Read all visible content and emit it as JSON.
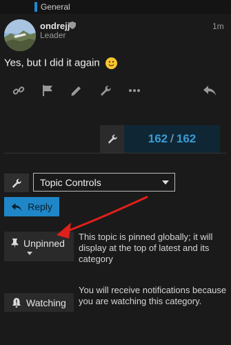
{
  "header": {
    "category": "General",
    "category_color": "#1e88d1"
  },
  "post": {
    "username": "ondrejj",
    "role": "Leader",
    "time": "1m",
    "body": "Yes, but I did it again",
    "emoji": "slight-smile"
  },
  "actions": [
    "link-icon",
    "flag-icon",
    "pencil-icon",
    "wrench-icon",
    "more-icon",
    "reply-arrow-icon"
  ],
  "progress": {
    "current": "162",
    "separator": "/",
    "total": "162"
  },
  "topic_controls": {
    "label": "Topic Controls"
  },
  "reply": {
    "label": "Reply"
  },
  "pin": {
    "label": "Unpinned",
    "description": "This topic is pinned globally; it will display at the top of latest and its category"
  },
  "notifications": {
    "label": "Watching",
    "description": "You will receive notifications because you are watching this category."
  },
  "colors": {
    "accent": "#1f87c8",
    "annotation": "#e0201b",
    "progress_text": "#3a9bd4"
  }
}
